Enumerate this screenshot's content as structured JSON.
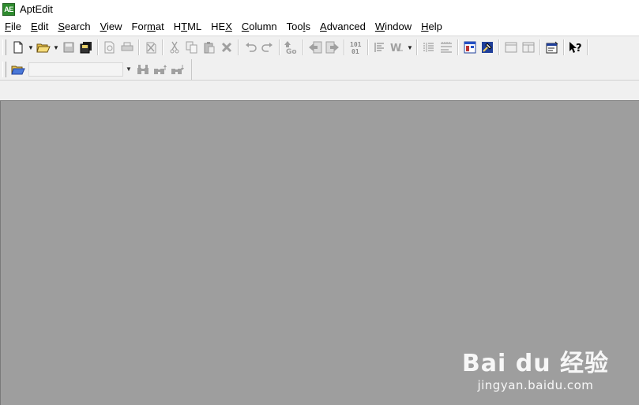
{
  "window": {
    "title": "AptEdit",
    "logo_text": "AE"
  },
  "menu": [
    {
      "pre": "",
      "key": "F",
      "post": "ile"
    },
    {
      "pre": "",
      "key": "E",
      "post": "dit"
    },
    {
      "pre": "",
      "key": "S",
      "post": "earch"
    },
    {
      "pre": "",
      "key": "V",
      "post": "iew"
    },
    {
      "pre": "For",
      "key": "m",
      "post": "at"
    },
    {
      "pre": "H",
      "key": "T",
      "post": "ML"
    },
    {
      "pre": "HE",
      "key": "X",
      "post": ""
    },
    {
      "pre": "",
      "key": "C",
      "post": "olumn"
    },
    {
      "pre": "Too",
      "key": "l",
      "post": "s"
    },
    {
      "pre": "",
      "key": "A",
      "post": "dvanced"
    },
    {
      "pre": "",
      "key": "W",
      "post": "indow"
    },
    {
      "pre": "",
      "key": "H",
      "post": "elp"
    }
  ],
  "toolbar": {
    "icons": {
      "new": "new-file-icon",
      "open": "open-folder-icon",
      "save": "save-icon",
      "save_all": "save-all-icon",
      "print_preview": "print-preview-icon",
      "print": "print-icon",
      "cut": "cut-icon",
      "copy": "copy-icon",
      "paste": "paste-icon",
      "delete": "delete-icon",
      "undo": "undo-icon",
      "redo": "redo-icon",
      "goto": "goto-icon",
      "hex": "hex-mode-icon",
      "word_wrap": "word-wrap-icon",
      "properties": "properties-icon",
      "help": "context-help-icon"
    },
    "goto_label": "Go",
    "hex_label_top": "101",
    "hex_label_bottom": "01",
    "help_label": "?"
  },
  "search_toolbar": {
    "combo_value": "",
    "icons": [
      "open-project-icon",
      "find-icon",
      "find-previous-icon",
      "find-next-icon"
    ]
  },
  "watermark": {
    "logo": "Bai du 经验",
    "url": "jingyan.baidu.com"
  }
}
